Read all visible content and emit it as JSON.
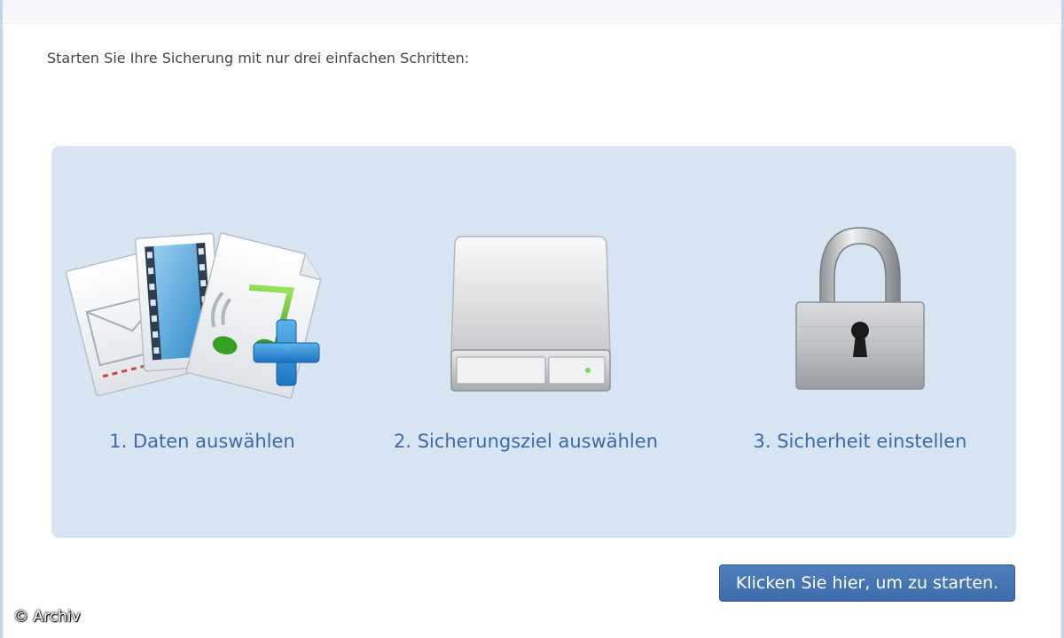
{
  "intro_text": "Starten Sie Ihre Sicherung mit nur drei einfachen Schritten:",
  "steps": [
    {
      "label": "1. Daten auswählen",
      "icon": "files-add-icon"
    },
    {
      "label": "2. Sicherungsziel auswählen",
      "icon": "hard-drive-icon"
    },
    {
      "label": "3. Sicherheit einstellen",
      "icon": "padlock-icon"
    }
  ],
  "start_button": "Klicken Sie hier, um zu starten.",
  "watermark": "© Archiv",
  "colors": {
    "panel": "#d6e5f1",
    "link": "#3d6aa6",
    "button": "#4574b4"
  }
}
